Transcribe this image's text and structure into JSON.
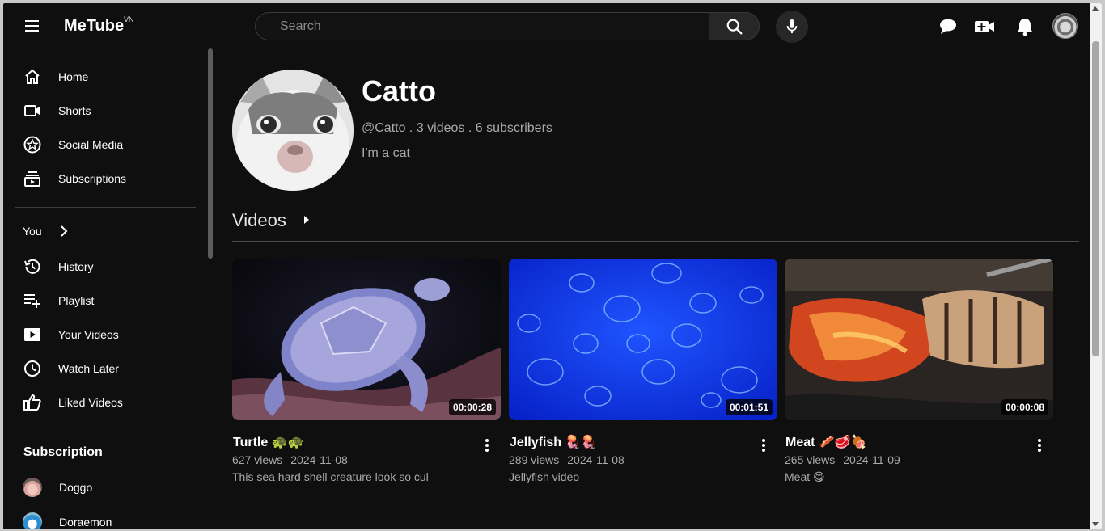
{
  "header": {
    "logo": "MeTube",
    "logo_region": "VN",
    "search_placeholder": "Search"
  },
  "sidebar": {
    "main_items": [
      {
        "label": "Home",
        "icon": "home-icon"
      },
      {
        "label": "Shorts",
        "icon": "shorts-icon"
      },
      {
        "label": "Social Media",
        "icon": "star-icon"
      },
      {
        "label": "Subscriptions",
        "icon": "subscriptions-icon"
      }
    ],
    "you_label": "You",
    "you_items": [
      {
        "label": "History",
        "icon": "history-icon"
      },
      {
        "label": "Playlist",
        "icon": "playlist-add-icon"
      },
      {
        "label": "Your Videos",
        "icon": "your-videos-icon"
      },
      {
        "label": "Watch Later",
        "icon": "clock-icon"
      },
      {
        "label": "Liked Videos",
        "icon": "thumbs-up-icon"
      }
    ],
    "subscription_title": "Subscription",
    "subscriptions": [
      {
        "name": "Doggo"
      },
      {
        "name": "Doraemon"
      }
    ]
  },
  "channel": {
    "name": "Catto",
    "meta": "@Catto . 3 videos . 6 subscribers",
    "description": "I'm a cat"
  },
  "videos_section": {
    "title": "Videos",
    "items": [
      {
        "title": "Turtle 🐢🐢",
        "views": "627 views",
        "date": "2024-11-08",
        "description": "This sea hard shell creature look so cul",
        "duration": "00:00:28"
      },
      {
        "title": "Jellyfish 🪼🪼",
        "views": "289 views",
        "date": "2024-11-08",
        "description": "Jellyfish video",
        "duration": "00:01:51"
      },
      {
        "title": "Meat 🥓🥩🍖",
        "views": "265 views",
        "date": "2024-11-09",
        "description": "Meat 😋",
        "duration": "00:00:08"
      }
    ]
  },
  "colors": {
    "background": "#0f0f0f",
    "text_secondary": "#aaaaaa",
    "divider": "#3d3d3d"
  }
}
